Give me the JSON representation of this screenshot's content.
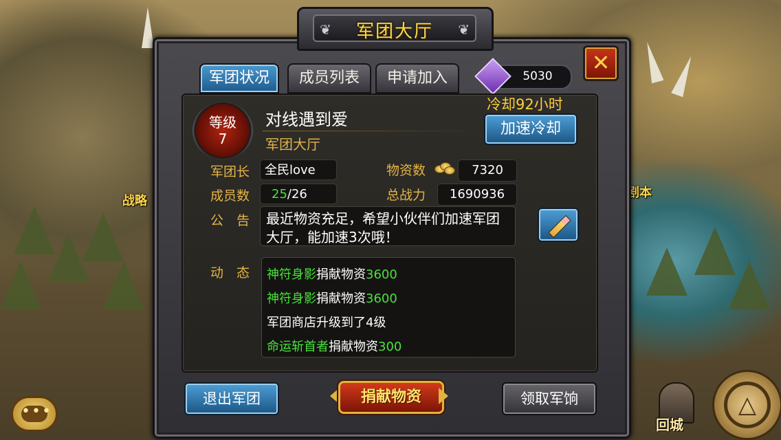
{
  "background": {
    "left_label": "战略",
    "right_label": "剧本",
    "return_label": "回城"
  },
  "title": "军团大厅",
  "currency": {
    "icon": "purple-gem-icon",
    "value": "5030"
  },
  "tabs": [
    {
      "label": "军团状况",
      "active": true
    },
    {
      "label": "成员列表",
      "active": false
    },
    {
      "label": "申请加入",
      "active": false
    }
  ],
  "guild": {
    "level_label": "等级",
    "level": "7",
    "name": "对线遇到爱",
    "building": "军团大厅",
    "cooldown": "冷却92小时",
    "speed_button": "加速冷却",
    "leader_label": "军团长",
    "leader": "全民love",
    "members_label": "成员数",
    "members_current": "25",
    "members_sep": "/",
    "members_max": "26",
    "resources_label": "物资数",
    "resources": "7320",
    "power_label": "总战力",
    "power": "1690936",
    "notice_label": "公　告",
    "notice": "最近物资充足，希望小伙伴们加速军团大厅，能加速3次哦！",
    "activity_label": "动　态",
    "activity": [
      {
        "name": "神符身影",
        "action": "捐献物资",
        "amount": "3600"
      },
      {
        "name": "神符身影",
        "action": "捐献物资",
        "amount": "3600"
      },
      {
        "name": "",
        "action": "军团商店升级到了4级",
        "amount": ""
      },
      {
        "name": "命运斩首者",
        "action": "捐献物资",
        "amount": "300"
      }
    ]
  },
  "buttons": {
    "quit": "退出军团",
    "donate": "捐献物资",
    "claim": "领取军饷"
  },
  "colors": {
    "gold_label": "#e3b545",
    "highlight_green": "#47e33a",
    "tab_active": "#1d5a8c"
  }
}
